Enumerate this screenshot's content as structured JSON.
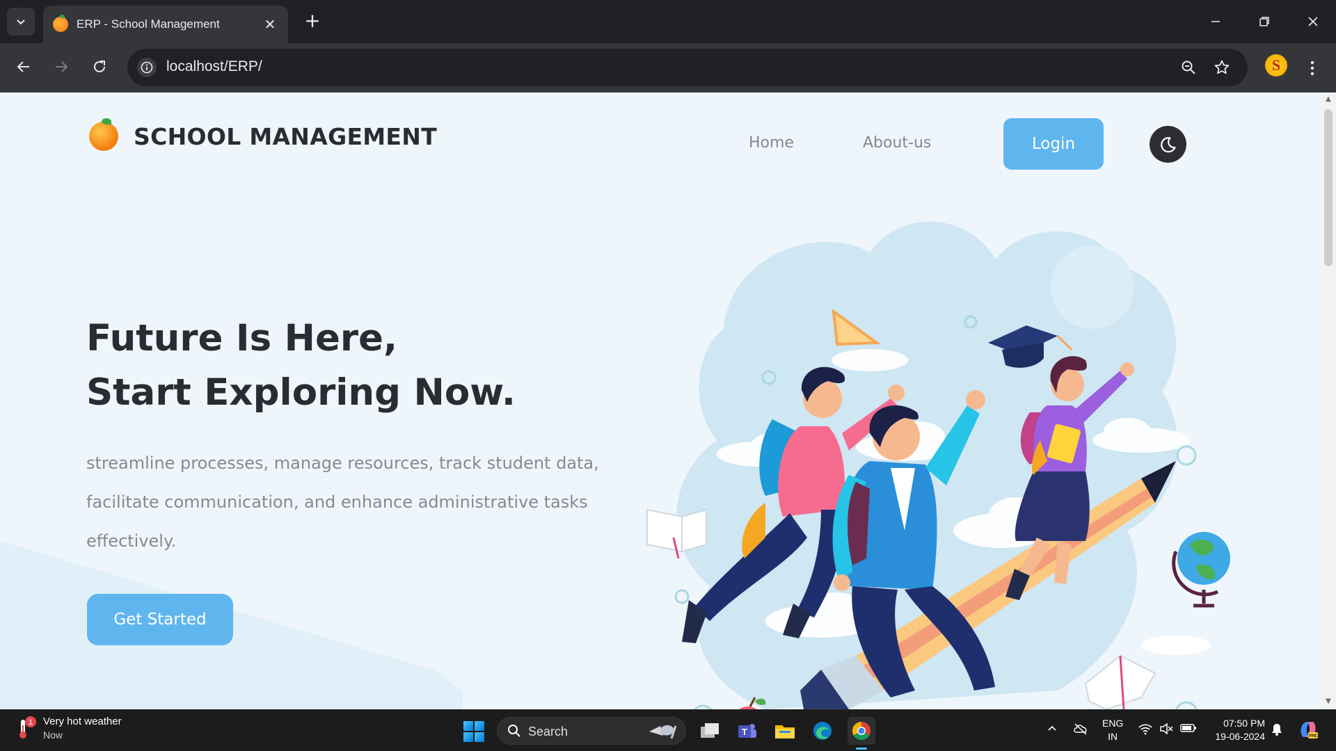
{
  "browser": {
    "tab_title": "ERP - School Management",
    "url": "localhost/ERP/",
    "profile_initial": "S"
  },
  "site": {
    "brand_name": "SCHOOL MANAGEMENT",
    "nav": {
      "home": "Home",
      "about": "About-us",
      "login": "Login"
    },
    "hero": {
      "title_line1": "Future Is Here,",
      "title_line2": "Start Exploring Now.",
      "description": "streamline processes, manage resources, track student data, facilitate communication, and enhance administrative tasks effectively.",
      "cta": "Get Started"
    },
    "colors": {
      "accent": "#5fb6ef",
      "background": "#eef6fb",
      "heading": "#2b2c33",
      "body_text": "#87898f"
    }
  },
  "taskbar": {
    "weather_title": "Very hot weather",
    "weather_sub": "Now",
    "weather_badge": "1",
    "search_label": "Search",
    "lang_line1": "ENG",
    "lang_line2": "IN",
    "time": "07:50 PM",
    "date": "19-06-2024",
    "apps": [
      "task-view-icon",
      "teams-icon",
      "file-explorer-icon",
      "edge-icon",
      "chrome-icon"
    ]
  }
}
